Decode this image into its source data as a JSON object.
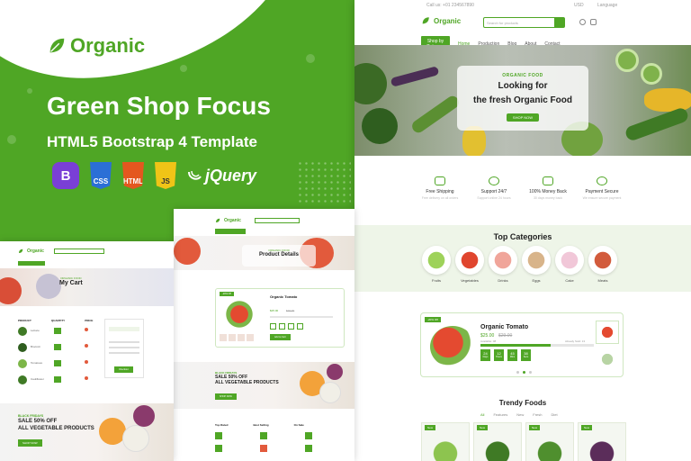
{
  "brand": {
    "name": "Organic"
  },
  "promo": {
    "title": "Green Shop Focus",
    "subtitle": "HTML5 Bootstrap 4 Template",
    "tech": [
      {
        "label": "B",
        "icon": "bootstrap-icon"
      },
      {
        "label": "CSS",
        "icon": "css3-icon"
      },
      {
        "label": "HTML",
        "icon": "html5-icon"
      },
      {
        "label": "JS",
        "icon": "javascript-icon"
      }
    ],
    "jquery": "jQuery"
  },
  "site": {
    "topbar": {
      "phone": "Call us: +01 234567890",
      "currency": "USD",
      "language": "Language"
    },
    "search_placeholder": "Search for products",
    "nav": [
      "Shop by Category",
      "Home",
      "Production",
      "Blog",
      "About",
      "Contact"
    ],
    "hero": {
      "kicker": "ORGANIC FOOD",
      "line1": "Looking for",
      "line2": "the fresh Organic Food",
      "button": "SHOP NOW"
    },
    "features": [
      {
        "title": "Free Shipping",
        "sub": "Free delivery on all orders"
      },
      {
        "title": "Support 24/7",
        "sub": "Support online 24 hours"
      },
      {
        "title": "100% Money Back",
        "sub": "30 days money back"
      },
      {
        "title": "Payment Secure",
        "sub": "We ensure secure payment"
      }
    ],
    "top_categories": {
      "title": "Top Categories",
      "items": [
        "Fruits",
        "Vegetables",
        "Drinks",
        "Eggs",
        "Cake",
        "Meats"
      ]
    },
    "deal": {
      "badge": "-20% Off",
      "name": "Organic Tomato",
      "price": "$25.00",
      "old_price": "$29.00",
      "available_label": "Available: 08",
      "sold_label": "Already Sold: 13",
      "countdown": [
        "24",
        "12",
        "45",
        "38"
      ],
      "countdown_labels": [
        "Days",
        "Hours",
        "Mins",
        "Secs"
      ]
    },
    "trendy": {
      "title": "Trendy Foods",
      "tabs": [
        "All",
        "Features",
        "New",
        "Fresh",
        "Diet"
      ],
      "badge": "New"
    }
  },
  "middle_page": {
    "breadcrumb_title": "Product Details",
    "breadcrumb_kicker": "ORGANIC FOOD",
    "product": {
      "badge": "-20% Off",
      "name": "Organic Tomato",
      "price": "$25.00",
      "old_price": "$29.00",
      "button": "Add to Cart"
    },
    "sale": {
      "kicker": "BLACK FRIDAYS",
      "line1": "SALE 50% OFF",
      "line2": "ALL VEGETABLE PRODUCTS",
      "button": "SHOP NOW"
    },
    "columns": [
      "Top Rated",
      "Best Selling",
      "On Sale"
    ]
  },
  "left_page": {
    "title": "My Cart",
    "kicker": "ORGANIC FOOD",
    "table_headers": [
      "PRODUCT",
      "QUANTITY",
      "PRICE"
    ],
    "rows": [
      "Lettuce",
      "Broccoli",
      "Tomatoes",
      "Cauliflower"
    ],
    "summary_button": "Checkout",
    "sale": {
      "kicker": "BLACK FRIDAYS",
      "line1": "SALE 50% OFF",
      "line2": "ALL VEGETABLE PRODUCTS",
      "button": "SHOP NOW"
    }
  },
  "colors": {
    "brand_green": "#4fa625",
    "light_green": "#eef5e8"
  }
}
